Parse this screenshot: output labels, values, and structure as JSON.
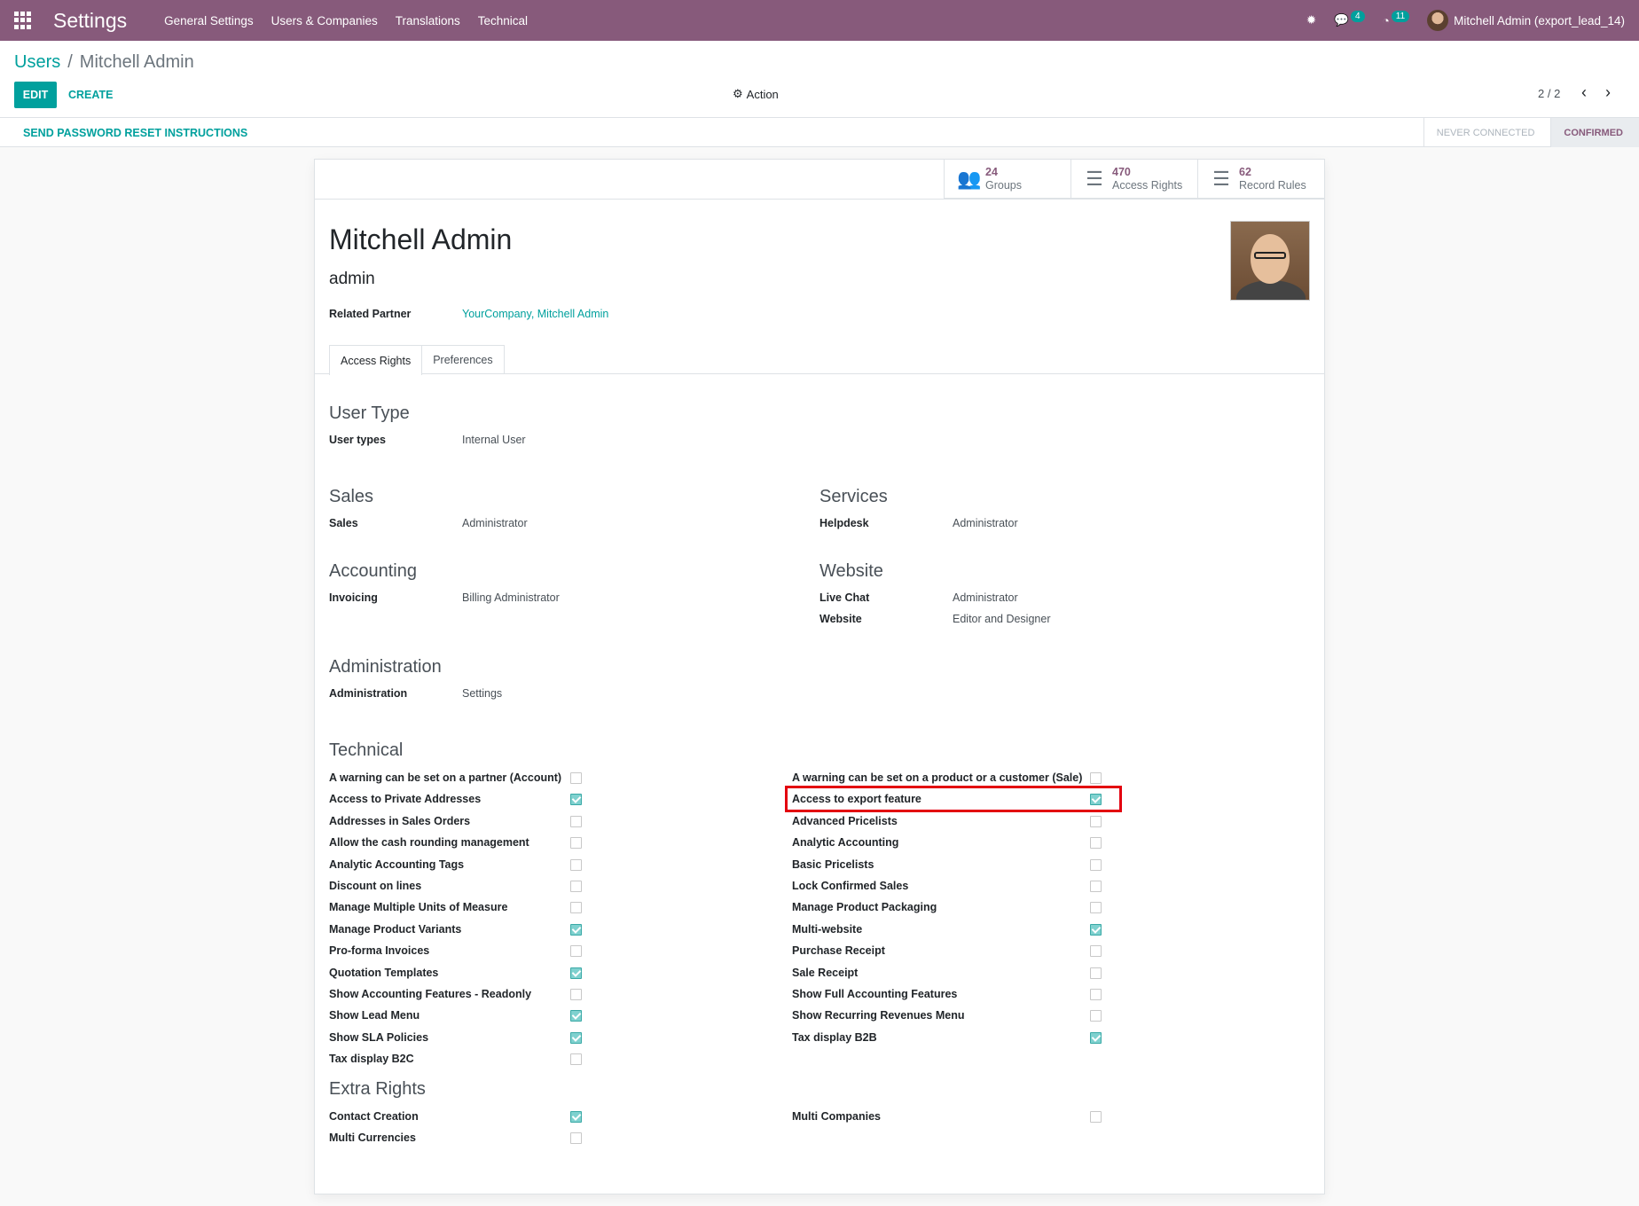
{
  "navbar": {
    "app_title": "Settings",
    "menu": [
      "General Settings",
      "Users & Companies",
      "Translations",
      "Technical"
    ],
    "messages_count": "4",
    "activities_count": "11",
    "user_label": "Mitchell Admin (export_lead_14)"
  },
  "breadcrumb": {
    "parent": "Users",
    "separator": "/",
    "current": "Mitchell Admin"
  },
  "buttons": {
    "edit": "EDIT",
    "create": "CREATE",
    "action": "Action",
    "send_reset": "SEND PASSWORD RESET INSTRUCTIONS"
  },
  "pager": {
    "value": "2 / 2"
  },
  "status": {
    "never": "NEVER CONNECTED",
    "confirmed": "CONFIRMED"
  },
  "smart_buttons": [
    {
      "value": "24",
      "label": "Groups",
      "icon": "users-icon"
    },
    {
      "value": "470",
      "label": "Access Rights",
      "icon": "list-icon"
    },
    {
      "value": "62",
      "label": "Record Rules",
      "icon": "list-icon"
    }
  ],
  "user": {
    "name": "Mitchell Admin",
    "login": "admin",
    "related_partner_label": "Related Partner",
    "related_partner": "YourCompany, Mitchell Admin"
  },
  "tabs": [
    "Access Rights",
    "Preferences"
  ],
  "groups": {
    "user_type": {
      "title": "User Type",
      "label": "User types",
      "value": "Internal User"
    },
    "sales": {
      "title": "Sales",
      "label": "Sales",
      "value": "Administrator"
    },
    "services": {
      "title": "Services",
      "label": "Helpdesk",
      "value": "Administrator"
    },
    "accounting": {
      "title": "Accounting",
      "label": "Invoicing",
      "value": "Billing Administrator"
    },
    "website": {
      "title": "Website",
      "rows": [
        {
          "label": "Live Chat",
          "value": "Administrator"
        },
        {
          "label": "Website",
          "value": "Editor and Designer"
        }
      ]
    },
    "administration": {
      "title": "Administration",
      "label": "Administration",
      "value": "Settings"
    }
  },
  "technical": {
    "title": "Technical",
    "left": [
      {
        "label": "A warning can be set on a partner (Account)",
        "checked": false
      },
      {
        "label": "Access to Private Addresses",
        "checked": true
      },
      {
        "label": "Addresses in Sales Orders",
        "checked": false
      },
      {
        "label": "Allow the cash rounding management",
        "checked": false
      },
      {
        "label": "Analytic Accounting Tags",
        "checked": false
      },
      {
        "label": "Discount on lines",
        "checked": false
      },
      {
        "label": "Manage Multiple Units of Measure",
        "checked": false
      },
      {
        "label": "Manage Product Variants",
        "checked": true
      },
      {
        "label": "Pro-forma Invoices",
        "checked": false
      },
      {
        "label": "Quotation Templates",
        "checked": true
      },
      {
        "label": "Show Accounting Features - Readonly",
        "checked": false
      },
      {
        "label": "Show Lead Menu",
        "checked": true
      },
      {
        "label": "Show SLA Policies",
        "checked": true
      },
      {
        "label": "Tax display B2C",
        "checked": false
      }
    ],
    "right": [
      {
        "label": "A warning can be set on a product or a customer (Sale)",
        "checked": false
      },
      {
        "label": "Access to export feature",
        "checked": true
      },
      {
        "label": "Advanced Pricelists",
        "checked": false
      },
      {
        "label": "Analytic Accounting",
        "checked": false
      },
      {
        "label": "Basic Pricelists",
        "checked": false
      },
      {
        "label": "Lock Confirmed Sales",
        "checked": false
      },
      {
        "label": "Manage Product Packaging",
        "checked": false
      },
      {
        "label": "Multi-website",
        "checked": true
      },
      {
        "label": "Purchase Receipt",
        "checked": false
      },
      {
        "label": "Sale Receipt",
        "checked": false
      },
      {
        "label": "Show Full Accounting Features",
        "checked": false
      },
      {
        "label": "Show Recurring Revenues Menu",
        "checked": false
      },
      {
        "label": "Tax display B2B",
        "checked": true
      }
    ]
  },
  "extra_rights": {
    "title": "Extra Rights",
    "left": [
      {
        "label": "Contact Creation",
        "checked": true
      },
      {
        "label": "Multi Currencies",
        "checked": false
      }
    ],
    "right": [
      {
        "label": "Multi Companies",
        "checked": false
      }
    ]
  },
  "colors": {
    "brand": "#875a7b",
    "accent": "#00a09d",
    "highlight": "#e3000f"
  }
}
